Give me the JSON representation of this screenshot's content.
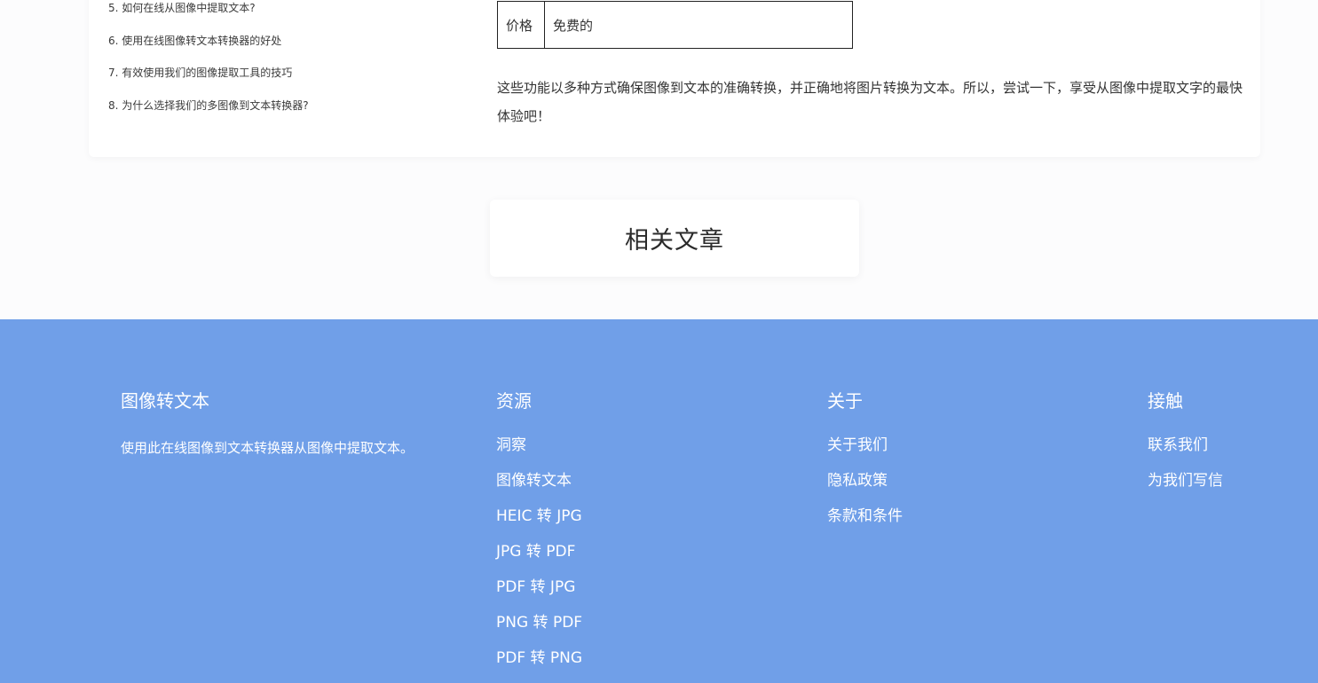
{
  "toc": {
    "items": [
      "5. 如何在线从图像中提取文本?",
      "6. 使用在线图像转文本转换器的好处",
      "7. 有效使用我们的图像提取工具的技巧",
      "8. 为什么选择我们的多图像到文本转换器?"
    ]
  },
  "price_table": {
    "label": "价格",
    "value": "免费的"
  },
  "summary": "这些功能以多种方式确保图像到文本的准确转换，并正确地将图片转换为文本。所以，尝试一下，享受从图像中提取文字的最快体验吧！",
  "related": {
    "title": "相关文章"
  },
  "footer": {
    "brand": {
      "title": "图像转文本",
      "description": "使用此在线图像到文本转换器从图像中提取文本。"
    },
    "resources": {
      "title": "资源",
      "links": [
        "洞察",
        "图像转文本",
        "HEIC 转 JPG",
        "JPG 转 PDF",
        "PDF 转 JPG",
        "PNG 转 PDF",
        "PDF 转 PNG"
      ]
    },
    "about": {
      "title": "关于",
      "links": [
        "关于我们",
        "隐私政策",
        "条款和条件"
      ]
    },
    "contact": {
      "title": "接触",
      "links": [
        "联系我们",
        "为我们写信"
      ]
    }
  },
  "colors": {
    "footer_bg": "#709fe8",
    "page_bg": "#fcfcfd",
    "card_bg": "#ffffff"
  }
}
